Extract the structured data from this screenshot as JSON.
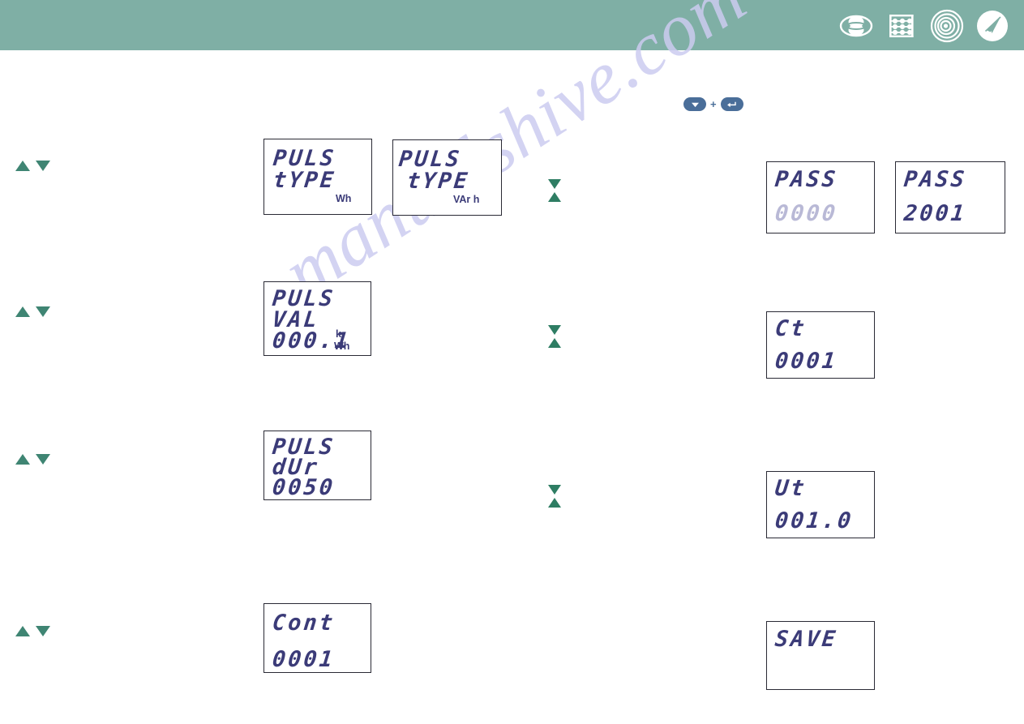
{
  "header": {
    "background_color": "#7fafa5",
    "logos": [
      {
        "name": "eye-ellipse-logo-icon",
        "label": "eye"
      },
      {
        "name": "abacus-logo-icon",
        "label": "abacus"
      },
      {
        "name": "spiral-target-logo-icon",
        "label": "spiral"
      },
      {
        "name": "compass-arrow-logo-icon",
        "label": "compass"
      }
    ]
  },
  "watermark": {
    "text": "manualshive.com",
    "color": "#ccccf0"
  },
  "key_combo": {
    "first_key": "down-arrow",
    "separator": "+",
    "second_key": "enter-arrow"
  },
  "lcd_color": "#3b3b78",
  "blink_color": "#b9b9d6",
  "displays": [
    {
      "id": "puls-type-wh",
      "lines": [
        "PULS",
        "tYPE"
      ],
      "value": "",
      "unit": "Wh",
      "unit_prefix": ""
    },
    {
      "id": "puls-type-varh",
      "lines": [
        "PULS",
        "tYPE"
      ],
      "value": "",
      "unit": "VAr  h",
      "unit_prefix": ""
    },
    {
      "id": "puls-val",
      "lines": [
        "PULS",
        "VAL"
      ],
      "value": "000.1",
      "unit": "Wh",
      "unit_prefix": "k"
    },
    {
      "id": "puls-dur",
      "lines": [
        "PULS",
        "dUr"
      ],
      "value": "0050",
      "unit": "",
      "unit_prefix": ""
    },
    {
      "id": "cont",
      "lines": [
        "Cont"
      ],
      "value": "0001",
      "unit": "",
      "unit_prefix": ""
    },
    {
      "id": "pass-0000",
      "lines": [
        "PASS"
      ],
      "value": "0000",
      "blink_digit": "first",
      "unit": "",
      "unit_prefix": ""
    },
    {
      "id": "pass-2001",
      "lines": [
        "PASS"
      ],
      "value": "2001",
      "blink_digit": "last",
      "unit": "",
      "unit_prefix": ""
    },
    {
      "id": "ct",
      "lines": [
        "Ct"
      ],
      "value": "0001",
      "unit": "",
      "unit_prefix": ""
    },
    {
      "id": "ut",
      "lines": [
        "Ut"
      ],
      "value": "001.0",
      "unit": "",
      "unit_prefix": ""
    },
    {
      "id": "save",
      "lines": [
        "SAVE"
      ],
      "value": "",
      "unit": "",
      "unit_prefix": ""
    }
  ],
  "nav": {
    "left_arrow_rows": [
      {
        "up": "▲",
        "down": "▼"
      },
      {
        "up": "▲",
        "down": "▼"
      },
      {
        "up": "▲",
        "down": "▼"
      },
      {
        "up": "▲",
        "down": "▼"
      }
    ],
    "center_arrow_pairs": [
      {
        "down": "▼",
        "up": "▲"
      },
      {
        "down": "▼",
        "up": "▲"
      },
      {
        "down": "▼",
        "up": "▲"
      }
    ]
  }
}
